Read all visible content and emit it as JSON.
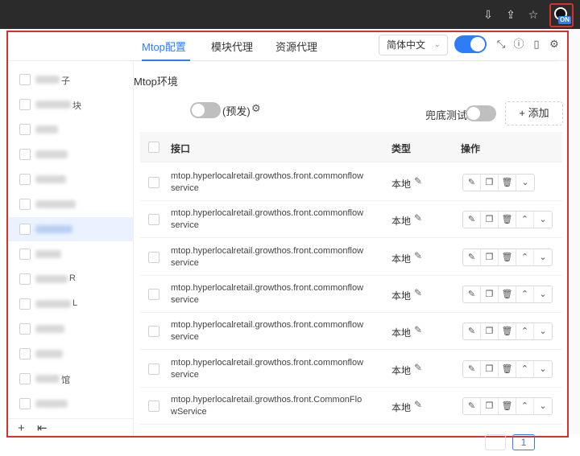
{
  "header": {
    "language": "简体中文",
    "toggle_on": true,
    "icons": [
      "compress-icon",
      "help-icon",
      "mobile-icon",
      "settings-icon"
    ]
  },
  "extension": {
    "badge": "ON"
  },
  "sidebar": {
    "active_index": 6,
    "items": [
      {
        "tail": "子"
      },
      {
        "tail": "块"
      },
      {
        "tail": ""
      },
      {
        "tail": ""
      },
      {
        "tail": ""
      },
      {
        "tail": ""
      },
      {
        "tail": ""
      },
      {
        "tail": ""
      },
      {
        "tail": "R"
      },
      {
        "tail": "L"
      },
      {
        "tail": ""
      },
      {
        "tail": ""
      },
      {
        "tail": "馆"
      },
      {
        "tail": ""
      }
    ],
    "footer_icons": [
      "add-icon",
      "import-icon"
    ]
  },
  "tabs": [
    {
      "label": "Mtop配置",
      "active": true
    },
    {
      "label": "模块代理",
      "active": false
    },
    {
      "label": "资源代理",
      "active": false
    }
  ],
  "toolbar": {
    "env_label": "Mtop环境",
    "env_state": "(预发)",
    "fallback_label": "兜底测试",
    "add_label": "+ 添加"
  },
  "table": {
    "columns": [
      "接口",
      "类型",
      "操作"
    ],
    "rows": [
      {
        "api": "mtop.hyperlocalretail.growthos.front.commonflowservice",
        "type": "本地",
        "has_up": false
      },
      {
        "api": "mtop.hyperlocalretail.growthos.front.commonflowservice",
        "type": "本地",
        "has_up": true
      },
      {
        "api": "mtop.hyperlocalretail.growthos.front.commonflowservice",
        "type": "本地",
        "has_up": true
      },
      {
        "api": "mtop.hyperlocalretail.growthos.front.commonflowservice",
        "type": "本地",
        "has_up": true
      },
      {
        "api": "mtop.hyperlocalretail.growthos.front.commonflowservice",
        "type": "本地",
        "has_up": true
      },
      {
        "api": "mtop.hyperlocalretail.growthos.front.commonflowservice",
        "type": "本地",
        "has_up": true
      },
      {
        "api": "mtop.hyperlocalretail.growthos.front.CommonFlowService",
        "type": "本地",
        "has_up": true
      }
    ]
  },
  "pagination": {
    "current": "1"
  }
}
